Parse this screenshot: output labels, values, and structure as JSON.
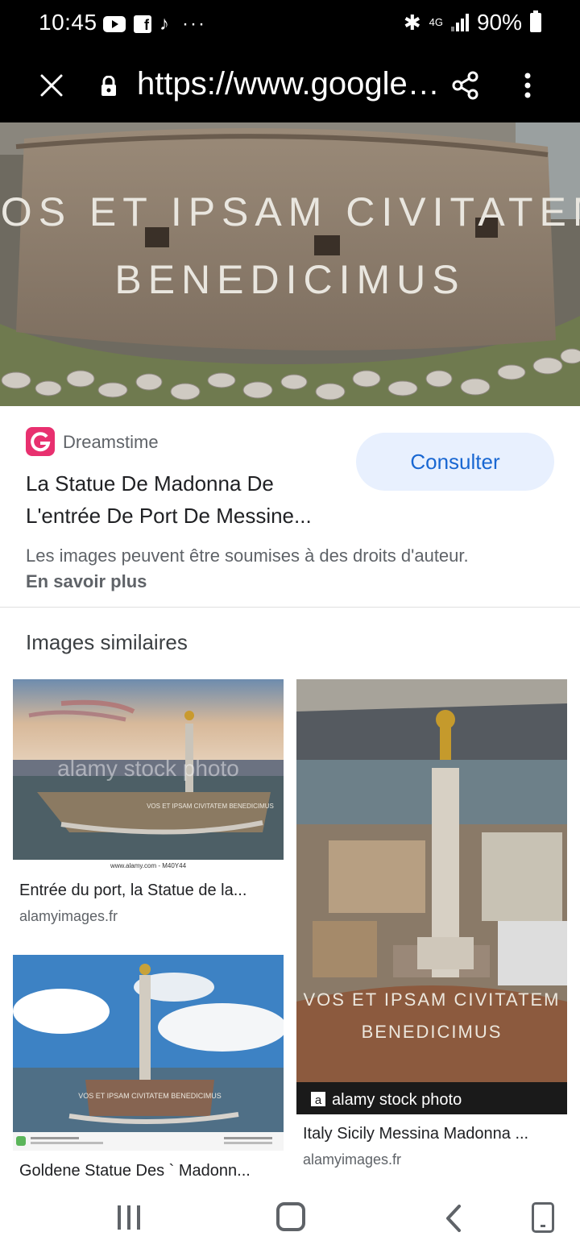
{
  "status_bar": {
    "time": "10:45",
    "more": "···",
    "network": "4G",
    "battery": "90%"
  },
  "browser": {
    "url": "https://www.google.com/imgres"
  },
  "hero": {
    "inscription_line1": "VOS ET IPSAM CIVITATEM",
    "inscription_line2": "BENEDICIMUS"
  },
  "source": {
    "name": "Dreamstime",
    "title_line1": "La Statue De Madonna De",
    "title_line2": "L'entrée De Port De Messine...",
    "visit_label": "Consulter",
    "copyright_text": "Les images peuvent être soumises à des droits d'auteur.",
    "learn_more": "En savoir plus"
  },
  "similar": {
    "heading": "Images similaires",
    "items": [
      {
        "title": "Entrée du port, la Statue de la...",
        "source": "alamyimages.fr",
        "watermark": "alamy stock photo",
        "caption": "www.alamy.com - M40Y44",
        "inscription": "VOS ET IPSAM CIVITATEM BENEDICIMUS"
      },
      {
        "title": "Goldene Statue Des ` Madonn...",
        "source": "",
        "watermark": "",
        "caption": "",
        "inscription": "VOS ET IPSAM CIVITATEM BENEDICIMUS"
      },
      {
        "title": "Italy Sicily Messina Madonna ...",
        "source": "alamyimages.fr",
        "watermark": "alamy stock photo",
        "caption": "",
        "inscription_line1": "VOS ET IPSAM CIVITATEM",
        "inscription_line2": "BENEDICIMUS"
      }
    ]
  },
  "colors": {
    "accent": "#1967d2",
    "button_bg": "#e8f0fe",
    "text_secondary": "#5f6368"
  }
}
